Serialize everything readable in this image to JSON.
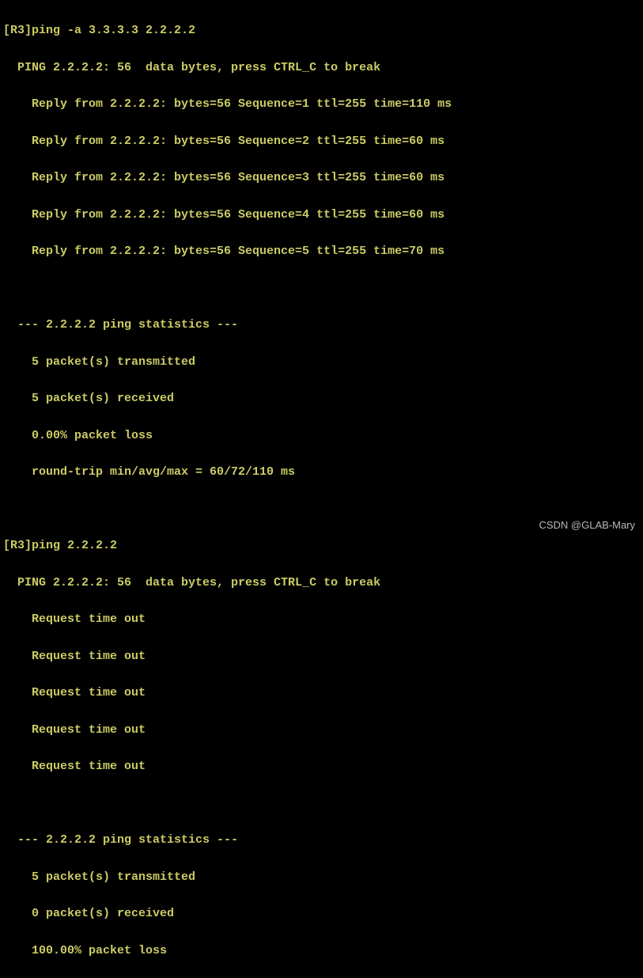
{
  "session1": {
    "prompt": "[R3]ping -a 3.3.3.3 2.2.2.2",
    "header": "  PING 2.2.2.2: 56  data bytes, press CTRL_C to break",
    "replies": [
      "    Reply from 2.2.2.2: bytes=56 Sequence=1 ttl=255 time=110 ms",
      "    Reply from 2.2.2.2: bytes=56 Sequence=2 ttl=255 time=60 ms",
      "    Reply from 2.2.2.2: bytes=56 Sequence=3 ttl=255 time=60 ms",
      "    Reply from 2.2.2.2: bytes=56 Sequence=4 ttl=255 time=60 ms",
      "    Reply from 2.2.2.2: bytes=56 Sequence=5 ttl=255 time=70 ms"
    ],
    "stats_header": "  --- 2.2.2.2 ping statistics ---",
    "stats": [
      "    5 packet(s) transmitted",
      "    5 packet(s) received",
      "    0.00% packet loss",
      "    round-trip min/avg/max = 60/72/110 ms"
    ]
  },
  "session2": {
    "prompt": "[R3]ping 2.2.2.2",
    "header": "  PING 2.2.2.2: 56  data bytes, press CTRL_C to break",
    "replies": [
      "    Request time out",
      "    Request time out",
      "    Request time out",
      "    Request time out",
      "    Request time out"
    ],
    "stats_header": "  --- 2.2.2.2 ping statistics ---",
    "stats": [
      "    5 packet(s) transmitted",
      "    0 packet(s) received",
      "    100.00% packet loss"
    ]
  },
  "watermark": "CSDN @GLAB-Mary"
}
